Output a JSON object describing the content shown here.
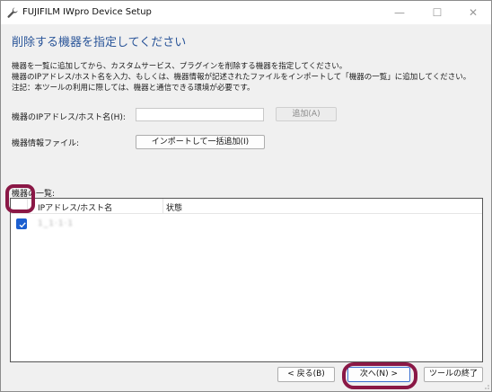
{
  "window": {
    "title": "FUJIFILM IWpro Device Setup",
    "minimize": "—",
    "maximize": "☐",
    "close": "✕"
  },
  "page": {
    "heading": "削除する機器を指定してください",
    "description": [
      "機器を一覧に追加してから、カスタムサービス、プラグインを削除する機器を指定してください。",
      "機器のIPアドレス/ホスト名を入力、もしくは、機器情報が記述されたファイルをインポートして「機器の一覧」に追加してください。",
      "注記：本ツールの利用に際しては、機器と通信できる環境が必要です。"
    ]
  },
  "form": {
    "ip_label": "機器のIPアドレス/ホスト名(H):",
    "ip_value": "",
    "add_button": "追加(A)",
    "file_label": "機器情報ファイル:",
    "import_button": "インポートして一括追加(I)"
  },
  "list": {
    "label": "機器の一覧:",
    "columns": [
      "IPアドレス/ホスト名",
      "状態"
    ],
    "rows": [
      {
        "checked": true,
        "ip": "1_1·1·1",
        "status": ""
      }
    ]
  },
  "footer": {
    "back_button": "< 戻る(B)",
    "next_button": "次へ(N) >",
    "exit_button": "ツールの終了"
  },
  "colors": {
    "heading": "#2a5599",
    "checkbox": "#1c5fd0",
    "highlight": "#8a1846"
  }
}
